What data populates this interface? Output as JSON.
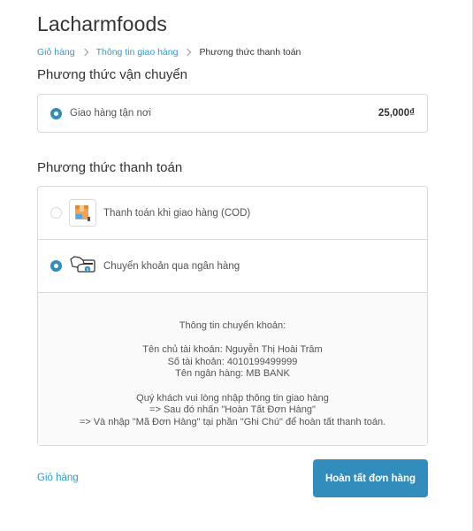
{
  "store": {
    "title": "Lacharmfoods"
  },
  "breadcrumb": {
    "items": [
      {
        "label": "Giỏ hàng",
        "link": true
      },
      {
        "label": "Thông tin giao hàng",
        "link": true
      },
      {
        "label": "Phương thức thanh toán",
        "link": false
      }
    ]
  },
  "shipping": {
    "heading": "Phương thức vận chuyển",
    "method": {
      "label": "Giao hàng tận nơi",
      "price": "25,000₫",
      "selected": true
    }
  },
  "payment": {
    "heading": "Phương thức thanh toán",
    "methods": [
      {
        "label": "Thanh toán khi giao hàng (COD)",
        "icon": "cod-box-icon",
        "selected": false
      },
      {
        "label": "Chuyển khoản qua ngân hàng",
        "icon": "bank-transfer-icon",
        "selected": true
      }
    ],
    "instructions": {
      "title": "Thông tin chuyển khoản:",
      "account_holder": "Tên chủ tài khoản: Nguyễn Thị Hoài Trâm",
      "account_number": "Số tài khoản: 4010199499999",
      "bank_name": "Tên ngân hàng: MB BANK",
      "note_1": "Quý khách vui lòng nhập thông tin giao hàng",
      "note_2": "=> Sau đó nhấn \"Hoàn Tất Đơn Hàng\"",
      "note_3": "=> Và nhập \"Mã Đơn Hàng\" tại phần \"Ghi Chú\" để hoàn tất thanh toán."
    }
  },
  "footer": {
    "back_label": "Giỏ hàng",
    "complete_label": "Hoàn tất đơn hàng"
  },
  "colors": {
    "accent": "#338dbc",
    "link": "#2a9dcc",
    "border": "#d9d9d9",
    "panel_bg": "#fafafa"
  }
}
